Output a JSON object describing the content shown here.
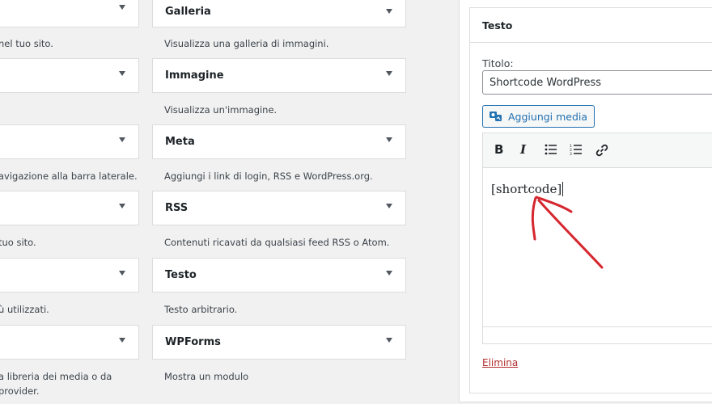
{
  "widgets_right": [
    {
      "title": "Galleria",
      "desc": "Visualizza una galleria di immagini."
    },
    {
      "title": "Immagine",
      "desc": "Visualizza un'immagine."
    },
    {
      "title": "Meta",
      "desc": "Aggiungi i link di login, RSS e WordPress.org."
    },
    {
      "title": "RSS",
      "desc": "Contenuti ricavati da qualsiasi feed RSS o Atom."
    },
    {
      "title": "Testo",
      "desc": "Testo arbitrario."
    },
    {
      "title": "WPForms",
      "desc": "Mostra un modulo"
    }
  ],
  "widgets_left_desc": [
    "nel tuo sito.",
    "",
    "avigazione alla barra laterale.",
    "tuo sito.",
    "ù utilizzati.",
    "a libreria dei media o da",
    "provider."
  ],
  "panel": {
    "title": "Testo",
    "titolo_label": "Titolo:",
    "titolo_value": "Shortcode WordPress",
    "media_button": "Aggiungi media",
    "toolbar": {
      "bold": "B",
      "italic": "I"
    },
    "content": "[shortcode]",
    "delete": "Elimina"
  },
  "colors": {
    "accent": "#2271b1",
    "annotation": "#d6262e",
    "delete": "#b32d2e"
  }
}
